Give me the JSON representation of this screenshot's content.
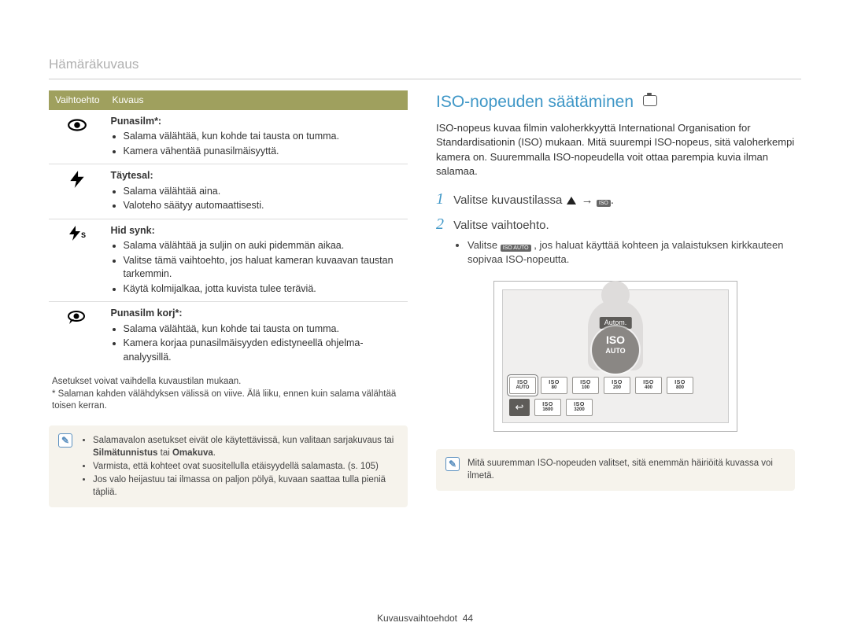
{
  "breadcrumb": "Hämäräkuvaus",
  "table": {
    "headers": [
      "Vaihtoehto",
      "Kuvaus"
    ],
    "rows": [
      {
        "icon": "eye",
        "title": "Punasilm*:",
        "bullets": [
          "Salama välähtää, kun kohde tai tausta on tumma.",
          "Kamera vähentää punasilmäisyyttä."
        ]
      },
      {
        "icon": "bolt",
        "title": "Täytesal:",
        "bullets": [
          "Salama välähtää aina.",
          "Valoteho säätyy automaattisesti."
        ]
      },
      {
        "icon": "bolt-s",
        "title": "Hid synk:",
        "bullets": [
          "Salama välähtää ja suljin on auki pidemmän aikaa.",
          "Valitse tämä vaihtoehto, jos haluat kameran kuvaavan taustan tarkemmin.",
          "Käytä kolmijalkaa, jotta kuvista tulee teräviä."
        ]
      },
      {
        "icon": "eye-fix",
        "title": "Punasilm korj*:",
        "bullets": [
          "Salama välähtää, kun kohde tai tausta on tumma.",
          "Kamera korjaa punasilmäisyyden edistyneellä ohjelma-analyysillä."
        ]
      }
    ],
    "subnotes": [
      "Asetukset voivat vaihdella kuvaustilan mukaan.",
      "* Salaman kahden välähdyksen välissä on viive. Älä liiku, ennen kuin salama välähtää toisen kerran."
    ]
  },
  "callout_left": {
    "items": [
      {
        "pre": "Salamavalon asetukset eivät ole käytettävissä, kun valitaan sarjakuvaus tai ",
        "bold": "Silmätunnistus",
        "mid": " tai ",
        "bold2": "Omakuva",
        "post": "."
      },
      {
        "text": "Varmista, että kohteet ovat suositellulla etäisyydellä salamasta. (s. 105)"
      },
      {
        "text": "Jos valo heijastuu tai ilmassa on paljon pölyä, kuvaan saattaa tulla pieniä täpliä."
      }
    ]
  },
  "iso": {
    "heading": "ISO-nopeuden säätäminen",
    "body": "ISO-nopeus kuvaa filmin valoherkkyyttä International Organisation for Standardisationin (ISO) mukaan. Mitä suurempi ISO-nopeus, sitä valoherkempi kamera on. Suuremmalla ISO-nopeudella voit ottaa parempia kuvia ilman salamaa.",
    "steps": {
      "step1": "Valitse kuvaustilassa",
      "step1_iso": "ISO",
      "step2": "Valitse vaihtoehto.",
      "step2_sub_a": "Valitse",
      "step2_sub_iso": "ISO AUTO",
      "step2_sub_b": ", jos haluat käyttää kohteen ja valaistuksen kirkkauteen sopivaa ISO-nopeutta."
    },
    "screen": {
      "autom": "Autom.",
      "big": "ISO",
      "big_sub": "AUTO",
      "tiles": [
        "AUTO",
        "80",
        "100",
        "200",
        "400",
        "800",
        "1600",
        "3200"
      ]
    },
    "note": "Mitä suuremman ISO-nopeuden valitset, sitä enemmän häiriöitä kuvassa voi ilmetä."
  },
  "footer": {
    "label": "Kuvausvaihtoehdot",
    "page": "44"
  }
}
